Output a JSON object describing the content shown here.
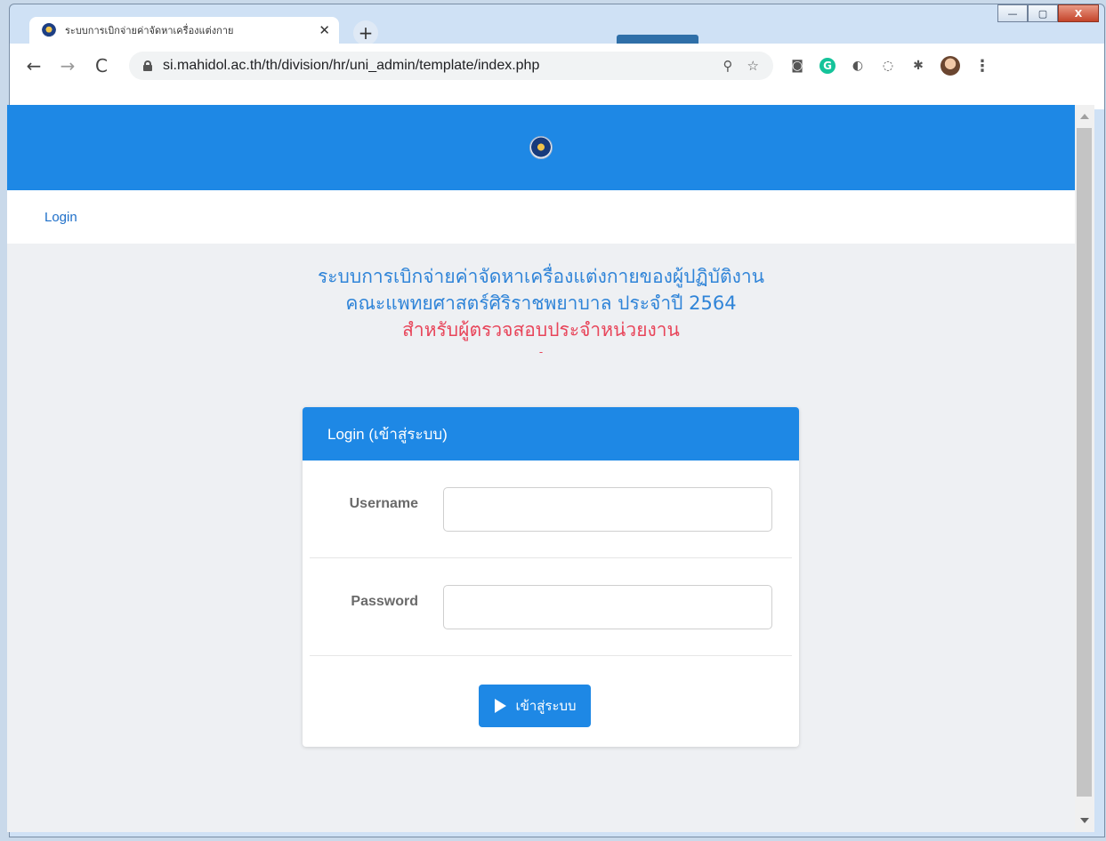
{
  "browser": {
    "tab_title": "ระบบการเบิกจ่ายค่าจัดหาเครื่องแต่งกาย",
    "tab_close": "✕",
    "new_tab": "+",
    "url": "si.mahidol.ac.th/th/division/hr/uni_admin/template/index.php",
    "back": "←",
    "forward": "→",
    "reload": "C",
    "zoom_icon": "⚲",
    "bookmark_icon": "☆",
    "extensions": [
      "camera-icon",
      "grammarly-icon",
      "circle-icon",
      "refresh-circle-icon",
      "puzzle-icon",
      "profile-avatar",
      "menu-kebab-icon"
    ],
    "window_buttons": [
      "—",
      "▢",
      "X"
    ]
  },
  "nav": {
    "login_link": "Login"
  },
  "page": {
    "title_line1": "ระบบการเบิกจ่ายค่าจัดหาเครื่องแต่งกายของผู้ปฏิบัติงาน",
    "title_line2": "คณะแพทยศาสตร์ศิริราชพยาบาล ประจำปี 2564",
    "title_line3": "สำหรับผู้ตรวจสอบประจำหน่วยงาน",
    "title_dash": "-"
  },
  "login_card": {
    "header": "Login (เข้าสู่ระบบ)",
    "username_label": "Username",
    "username_value": "",
    "password_label": "Password",
    "password_value": "",
    "submit_label": "เข้าสู่ระบบ"
  },
  "colors": {
    "brand_blue": "#1e88e5",
    "title_blue": "#2f84d8",
    "title_red": "#e8455a"
  }
}
